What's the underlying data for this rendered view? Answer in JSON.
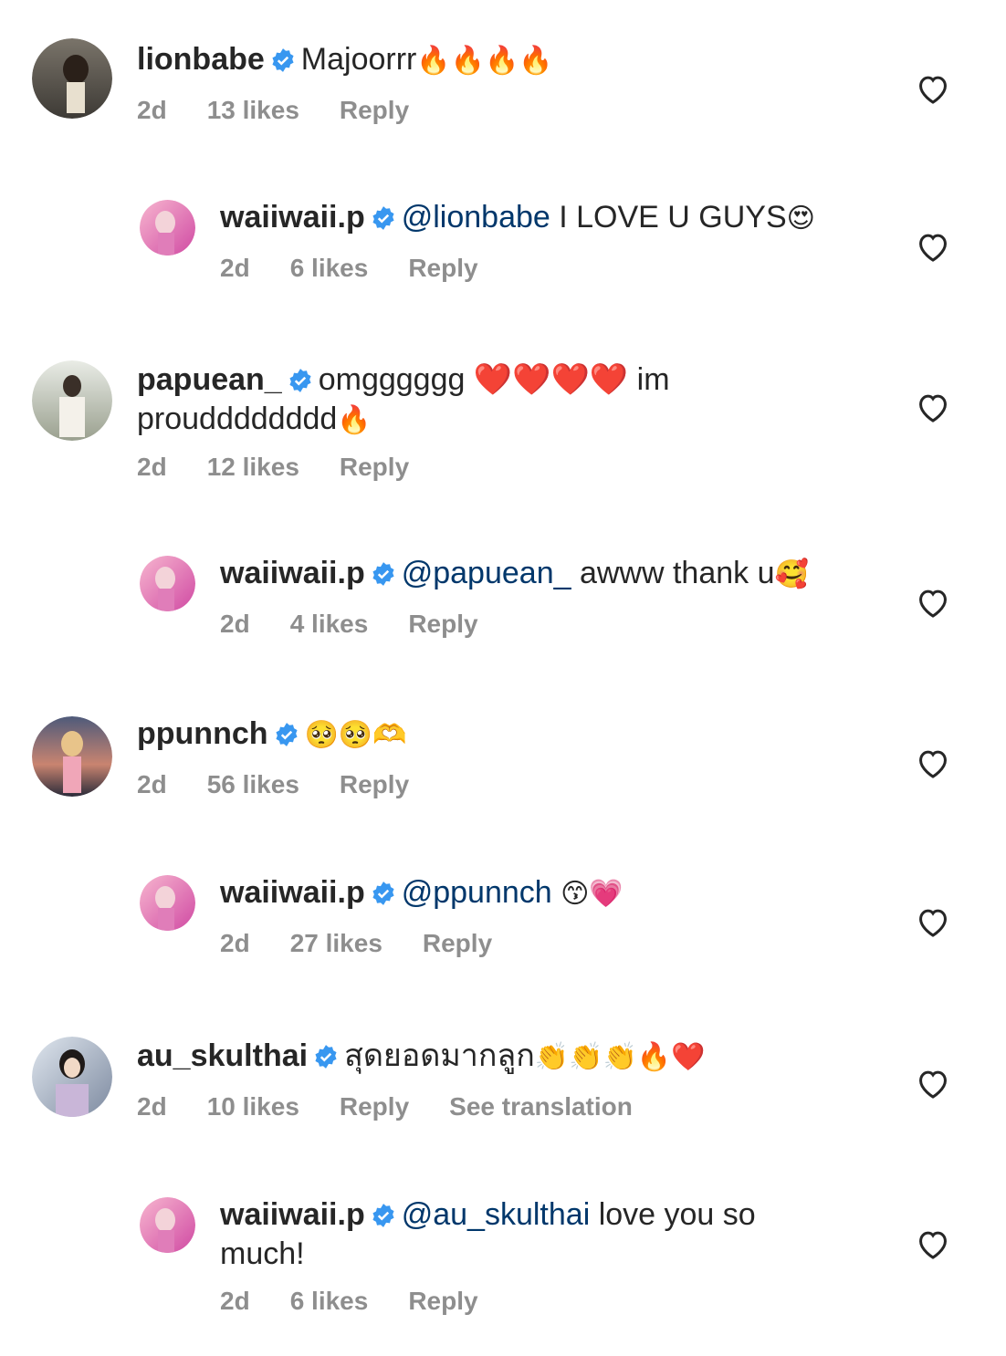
{
  "colors": {
    "mention": "#00376b",
    "meta": "#8e8e8e",
    "verified": "#3897f0",
    "text": "#262626"
  },
  "icons": {
    "verified": "verified-badge-icon",
    "like": "heart-outline-icon"
  },
  "comments": [
    {
      "user": "lionbabe",
      "verified": true,
      "mention": "",
      "text": "Majoorrr",
      "emoji": "🔥🔥🔥🔥",
      "time": "2d",
      "likes": "13 likes",
      "reply": "Reply",
      "translate": ""
    },
    {
      "user": "waiiwaii.p",
      "verified": true,
      "mention": "@lionbabe",
      "text": " I LOVE U GUYS",
      "emoji": "😍",
      "time": "2d",
      "likes": "6 likes",
      "reply": "Reply",
      "translate": ""
    },
    {
      "user": "papuean_",
      "verified": true,
      "mention": "",
      "text": "omgggggg ❤️❤️❤️❤️ im proudddddddd",
      "emoji": "🔥",
      "time": "2d",
      "likes": "12 likes",
      "reply": "Reply",
      "translate": ""
    },
    {
      "user": "waiiwaii.p",
      "verified": true,
      "mention": "@papuean_",
      "text": " awww thank u",
      "emoji": "🥰",
      "time": "2d",
      "likes": "4 likes",
      "reply": "Reply",
      "translate": ""
    },
    {
      "user": "ppunnch",
      "verified": true,
      "mention": "",
      "text": "",
      "emoji": "🥺🥺🫶",
      "time": "2d",
      "likes": "56 likes",
      "reply": "Reply",
      "translate": ""
    },
    {
      "user": "waiiwaii.p",
      "verified": true,
      "mention": "@ppunnch",
      "text": " ",
      "emoji": "😙💗",
      "time": "2d",
      "likes": "27 likes",
      "reply": "Reply",
      "translate": ""
    },
    {
      "user": "au_skulthai",
      "verified": true,
      "mention": "",
      "text": "สุดยอดมากลูก",
      "emoji": "👏👏👏🔥❤️",
      "time": "2d",
      "likes": "10 likes",
      "reply": "Reply",
      "translate": "See translation"
    },
    {
      "user": "waiiwaii.p",
      "verified": true,
      "mention": "@au_skulthai",
      "text": " love you so much!",
      "emoji": "",
      "time": "2d",
      "likes": "6 likes",
      "reply": "Reply",
      "translate": ""
    }
  ]
}
